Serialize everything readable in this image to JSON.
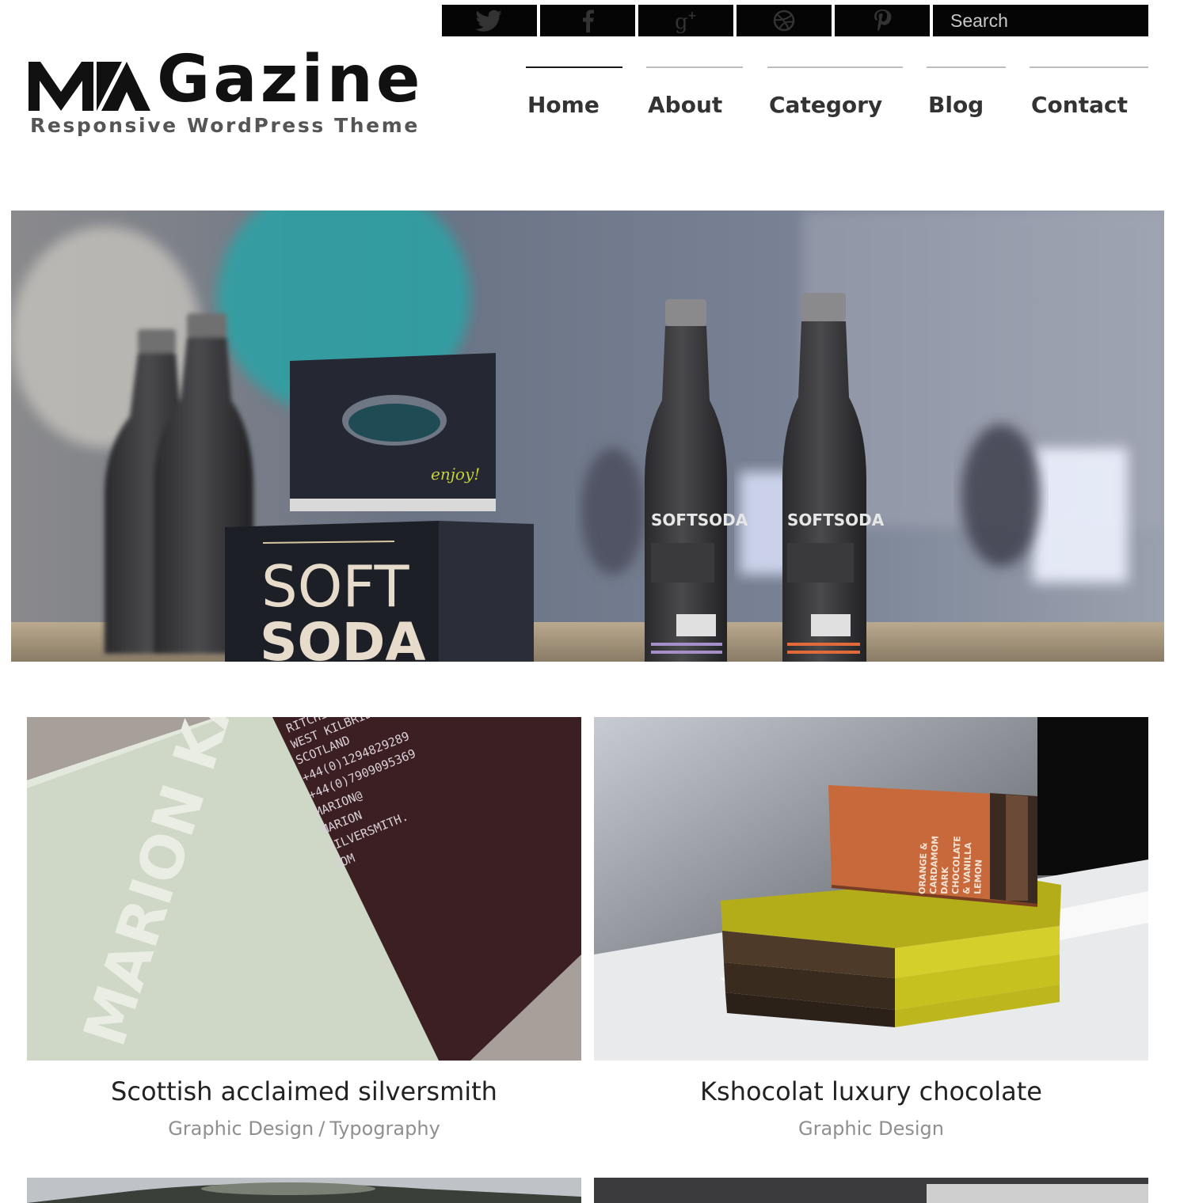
{
  "social": {
    "buttons": [
      {
        "name": "twitter",
        "icon": "twitter-bird-icon"
      },
      {
        "name": "facebook",
        "icon": "facebook-f-icon"
      },
      {
        "name": "google-plus",
        "icon": "google-plus-icon"
      },
      {
        "name": "dribbble",
        "icon": "dribbble-ball-icon"
      },
      {
        "name": "pinterest",
        "icon": "pinterest-p-icon"
      }
    ],
    "search_placeholder": "Search"
  },
  "logo": {
    "text_part": "Gazine",
    "tagline": "Responsive WordPress Theme"
  },
  "nav": {
    "items": [
      {
        "label": "Home",
        "active": true
      },
      {
        "label": "About",
        "active": false
      },
      {
        "label": "Category",
        "active": false
      },
      {
        "label": "Blog",
        "active": false
      },
      {
        "label": "Contact",
        "active": false
      }
    ]
  },
  "hero": {
    "box_brand_line1": "SOFT",
    "box_brand_line2": "SODA",
    "bottle_label": "SOFTSODA",
    "handwritten": "enjoy!"
  },
  "posts": [
    {
      "title": "Scottish acclaimed silversmith",
      "categories": [
        "Graphic Design",
        "Typography"
      ],
      "image_text": "MARION KANE"
    },
    {
      "title": "Kshocolat luxury chocolate",
      "categories": [
        "Graphic Design"
      ]
    }
  ],
  "colors": {
    "social_bar": "#050505",
    "nav_active_line": "#1a1a1a",
    "nav_line": "#bdbdbd",
    "text_dark": "#222222",
    "text_muted": "#8f8f8f"
  }
}
